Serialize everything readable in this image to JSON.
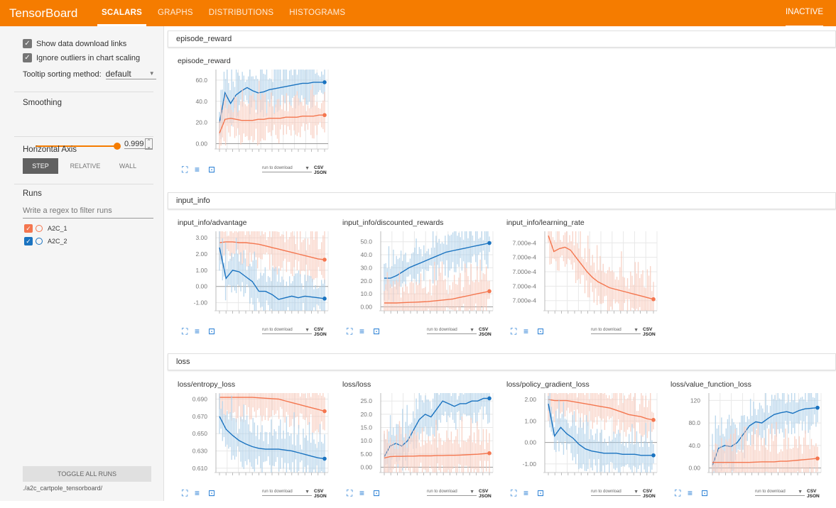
{
  "topbar": {
    "brand": "TensorBoard",
    "tabs": [
      "SCALARS",
      "GRAPHS",
      "DISTRIBUTIONS",
      "HISTOGRAMS"
    ],
    "status": "INACTIVE"
  },
  "sidebar": {
    "show_download_links": "Show data download links",
    "ignore_outliers": "Ignore outliers in chart scaling",
    "tooltip_label": "Tooltip sorting method:",
    "tooltip_value": "default",
    "smoothing_label": "Smoothing",
    "smoothing_value": "0.999",
    "smoothing_fraction": 0.999,
    "axis_label": "Horizontal Axis",
    "axis_options": [
      "STEP",
      "RELATIVE",
      "WALL"
    ],
    "axis_selected": "STEP",
    "runs_label": "Runs",
    "runs_placeholder": "Write a regex to filter runs",
    "runs": [
      {
        "name": "A2C_1",
        "color": "#f4764f"
      },
      {
        "name": "A2C_2",
        "color": "#1a73c0"
      }
    ],
    "toggle_all": "TOGGLE ALL RUNS",
    "logdir": "./a2c_cartpole_tensorboard/"
  },
  "card_footer": {
    "download_placeholder": "run to download",
    "links": "CSV JSON"
  },
  "icons": [
    "expand-icon",
    "lines-icon",
    "fit-domain-icon",
    "dropdown-icon"
  ],
  "sections": [
    {
      "title": "episode_reward"
    },
    {
      "title": "input_info"
    },
    {
      "title": "loss"
    }
  ],
  "chart_data": [
    {
      "type": "line",
      "title": "episode_reward",
      "yticks": [
        "60.0",
        "40.0",
        "20.0",
        "0.00"
      ],
      "ytick_values": [
        60,
        40,
        20,
        0
      ],
      "ylim": [
        -5,
        70
      ],
      "series": [
        {
          "name": "A2C_2",
          "color": "#1a73c0",
          "values": [
            20,
            48,
            38,
            46,
            50,
            53,
            50,
            48,
            49,
            51,
            52,
            53,
            54,
            55,
            56,
            57,
            57,
            58,
            58,
            58
          ]
        },
        {
          "name": "A2C_1",
          "color": "#f4764f",
          "values": [
            10,
            23,
            24,
            23,
            22,
            22,
            22,
            23,
            23,
            24,
            24,
            24,
            25,
            25,
            25,
            26,
            26,
            26,
            27,
            27
          ]
        }
      ]
    },
    {
      "type": "line",
      "title": "input_info/advantage",
      "yticks": [
        "3.00",
        "2.00",
        "1.00",
        "0.00",
        "-1.00"
      ],
      "ytick_values": [
        3,
        2,
        1,
        0,
        -1
      ],
      "ylim": [
        -1.5,
        3.4
      ],
      "series": [
        {
          "name": "A2C_1",
          "color": "#f4764f",
          "values": [
            2.7,
            2.75,
            2.75,
            2.7,
            2.7,
            2.65,
            2.6,
            2.5,
            2.4,
            2.3,
            2.2,
            2.1,
            2.0,
            1.9,
            1.8,
            1.7,
            1.65
          ]
        },
        {
          "name": "A2C_2",
          "color": "#1a73c0",
          "values": [
            2.4,
            0.5,
            1.0,
            0.9,
            0.6,
            0.3,
            -0.3,
            -0.3,
            -0.5,
            -0.8,
            -0.7,
            -0.6,
            -0.7,
            -0.6,
            -0.65,
            -0.7,
            -0.75
          ]
        }
      ]
    },
    {
      "type": "line",
      "title": "input_info/discounted_rewards",
      "yticks": [
        "50.0",
        "40.0",
        "30.0",
        "20.0",
        "10.0",
        "0.00"
      ],
      "ytick_values": [
        50,
        40,
        30,
        20,
        10,
        0
      ],
      "ylim": [
        -3,
        58
      ],
      "series": [
        {
          "name": "A2C_2",
          "color": "#1a73c0",
          "values": [
            22,
            22,
            24,
            27,
            30,
            32,
            34,
            36,
            38,
            40,
            42,
            43,
            44,
            45,
            46,
            47,
            48,
            49
          ]
        },
        {
          "name": "A2C_1",
          "color": "#f4764f",
          "values": [
            3,
            3,
            3,
            3.2,
            3.4,
            3.6,
            3.8,
            4,
            4.5,
            5,
            5.5,
            6,
            7,
            8,
            9,
            10,
            11,
            12
          ]
        }
      ]
    },
    {
      "type": "line",
      "title": "input_info/learning_rate",
      "yticks": [
        "7.000e-4",
        "7.000e-4",
        "7.000e-4",
        "7.000e-4",
        "7.000e-4"
      ],
      "ytick_values": [
        5,
        4,
        3,
        2,
        1
      ],
      "ylim": [
        0.3,
        5.8
      ],
      "series": [
        {
          "name": "A2C_1",
          "color": "#f4764f",
          "values": [
            5.5,
            4.4,
            4.6,
            4.7,
            4.5,
            4.0,
            3.5,
            3.0,
            2.6,
            2.3,
            2.1,
            1.9,
            1.8,
            1.7,
            1.6,
            1.5,
            1.4,
            1.3,
            1.2,
            1.1
          ]
        }
      ]
    },
    {
      "type": "line",
      "title": "loss/entropy_loss",
      "yticks": [
        "0.690",
        "0.670",
        "0.650",
        "0.630",
        "0.610"
      ],
      "ytick_values": [
        0.69,
        0.67,
        0.65,
        0.63,
        0.61
      ],
      "ylim": [
        0.605,
        0.697
      ],
      "series": [
        {
          "name": "A2C_1",
          "color": "#f4764f",
          "values": [
            0.692,
            0.692,
            0.692,
            0.692,
            0.692,
            0.692,
            0.6915,
            0.691,
            0.6905,
            0.69,
            0.688,
            0.686,
            0.684,
            0.682,
            0.68,
            0.678,
            0.676
          ]
        },
        {
          "name": "A2C_2",
          "color": "#1a73c0",
          "values": [
            0.67,
            0.655,
            0.648,
            0.642,
            0.638,
            0.635,
            0.633,
            0.632,
            0.632,
            0.632,
            0.631,
            0.63,
            0.628,
            0.626,
            0.624,
            0.622,
            0.621
          ]
        }
      ]
    },
    {
      "type": "line",
      "title": "loss/loss",
      "yticks": [
        "25.0",
        "20.0",
        "15.0",
        "10.0",
        "5.00",
        "0.00"
      ],
      "ytick_values": [
        25,
        20,
        15,
        10,
        5,
        0
      ],
      "ylim": [
        -2,
        28
      ],
      "series": [
        {
          "name": "A2C_2",
          "color": "#1a73c0",
          "values": [
            4,
            8,
            9,
            8,
            10,
            14,
            18,
            20,
            19,
            22,
            25,
            24,
            23,
            24,
            24,
            25,
            25,
            26,
            26
          ]
        },
        {
          "name": "A2C_1",
          "color": "#f4764f",
          "values": [
            3.5,
            4,
            4.1,
            4.1,
            4.2,
            4.2,
            4.3,
            4.3,
            4.3,
            4.4,
            4.4,
            4.5,
            4.5,
            4.6,
            4.7,
            4.8,
            4.9,
            5.1,
            5.3
          ]
        }
      ]
    },
    {
      "type": "line",
      "title": "loss/policy_gradient_loss",
      "yticks": [
        "2.00",
        "1.00",
        "0.00",
        "-1.00"
      ],
      "ytick_values": [
        2,
        1,
        0,
        -1
      ],
      "ylim": [
        -1.4,
        2.3
      ],
      "series": [
        {
          "name": "A2C_1",
          "color": "#f4764f",
          "values": [
            2.0,
            1.95,
            1.95,
            1.95,
            1.9,
            1.85,
            1.8,
            1.75,
            1.7,
            1.65,
            1.6,
            1.5,
            1.4,
            1.3,
            1.25,
            1.2,
            1.1,
            1.05
          ]
        },
        {
          "name": "A2C_2",
          "color": "#1a73c0",
          "values": [
            1.8,
            0.3,
            0.7,
            0.4,
            0.2,
            -0.1,
            -0.3,
            -0.4,
            -0.45,
            -0.5,
            -0.5,
            -0.5,
            -0.55,
            -0.55,
            -0.55,
            -0.6,
            -0.6,
            -0.6
          ]
        }
      ]
    },
    {
      "type": "line",
      "title": "loss/value_function_loss",
      "yticks": [
        "120",
        "80.0",
        "40.0",
        "0.00"
      ],
      "ytick_values": [
        120,
        80,
        40,
        0
      ],
      "ylim": [
        -8,
        133
      ],
      "series": [
        {
          "name": "A2C_2",
          "color": "#1a73c0",
          "values": [
            5,
            35,
            40,
            38,
            45,
            60,
            75,
            82,
            80,
            88,
            95,
            98,
            100,
            97,
            102,
            105,
            106,
            107
          ]
        },
        {
          "name": "A2C_1",
          "color": "#f4764f",
          "values": [
            10,
            10,
            10,
            10,
            10,
            10,
            10,
            10.5,
            11,
            11,
            11,
            12,
            12,
            13,
            14,
            15,
            16,
            17
          ]
        }
      ]
    }
  ]
}
